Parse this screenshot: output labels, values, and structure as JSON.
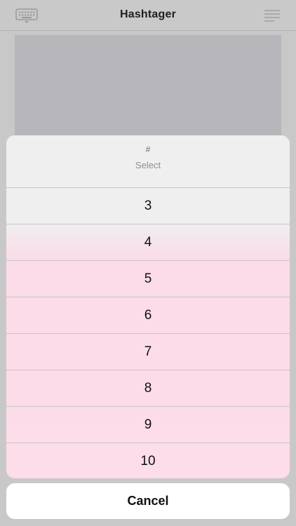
{
  "navbar": {
    "title": "Hashtager",
    "left_icon": "keyboard-icon",
    "right_icon": "menu-lines-icon"
  },
  "sheet": {
    "symbol": "#",
    "subtitle": "Select",
    "options": [
      "3",
      "4",
      "5",
      "6",
      "7",
      "8",
      "9",
      "10"
    ]
  },
  "cancel": {
    "label": "Cancel"
  },
  "colors": {
    "background": "#c8c8c8",
    "sheet_top": "#efeff0",
    "sheet_tint": "#fddde9",
    "separator": "#c6c6c8"
  }
}
